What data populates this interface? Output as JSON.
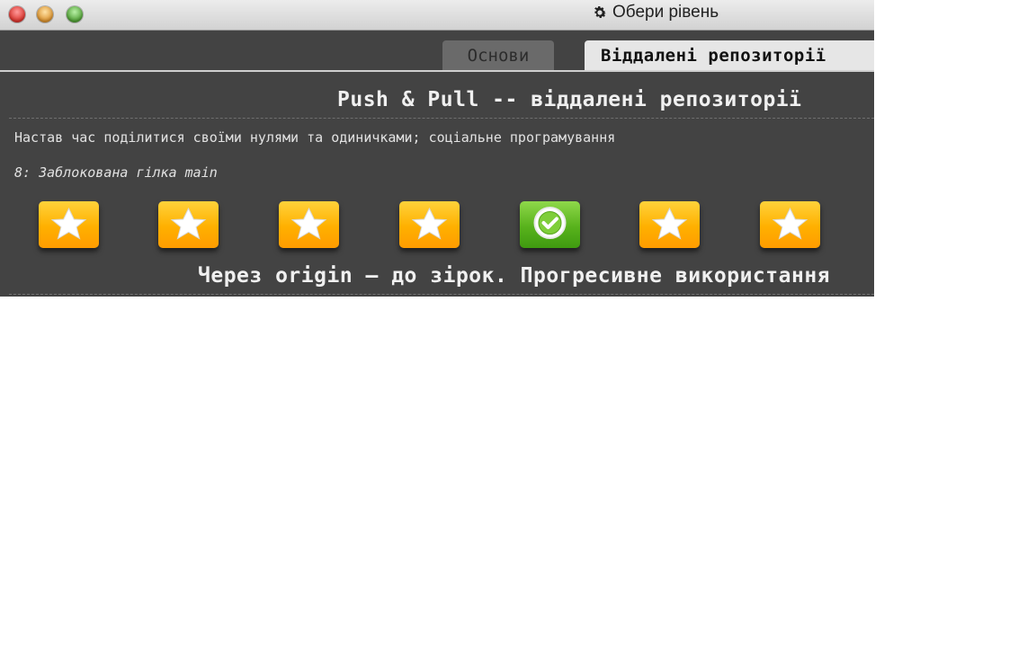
{
  "window": {
    "title": "Обери рівень",
    "title_icon": "gear-icon"
  },
  "tabs": [
    {
      "label": "Основи",
      "active": false
    },
    {
      "label": "Віддалені репозиторії",
      "active": true
    }
  ],
  "section": {
    "title": "Push & Pull -- віддалені репозиторії",
    "description": "Настав час поділитися своїми нулями та одиничками; соціальне програмування",
    "level_name": "8: Заблокована гілка main"
  },
  "levels": [
    {
      "icon": "star-icon",
      "status": "unsolved"
    },
    {
      "icon": "star-icon",
      "status": "unsolved"
    },
    {
      "icon": "star-icon",
      "status": "unsolved"
    },
    {
      "icon": "star-icon",
      "status": "unsolved"
    },
    {
      "icon": "checkmark-icon",
      "status": "solved"
    },
    {
      "icon": "star-icon",
      "status": "unsolved"
    },
    {
      "icon": "star-icon",
      "status": "unsolved"
    }
  ],
  "next_section": {
    "title": "Через origin – до зірок. Прогресивне використання"
  },
  "colors": {
    "background": "#434343",
    "star_tile": "#ffb000",
    "solved_tile": "#58b21c"
  }
}
